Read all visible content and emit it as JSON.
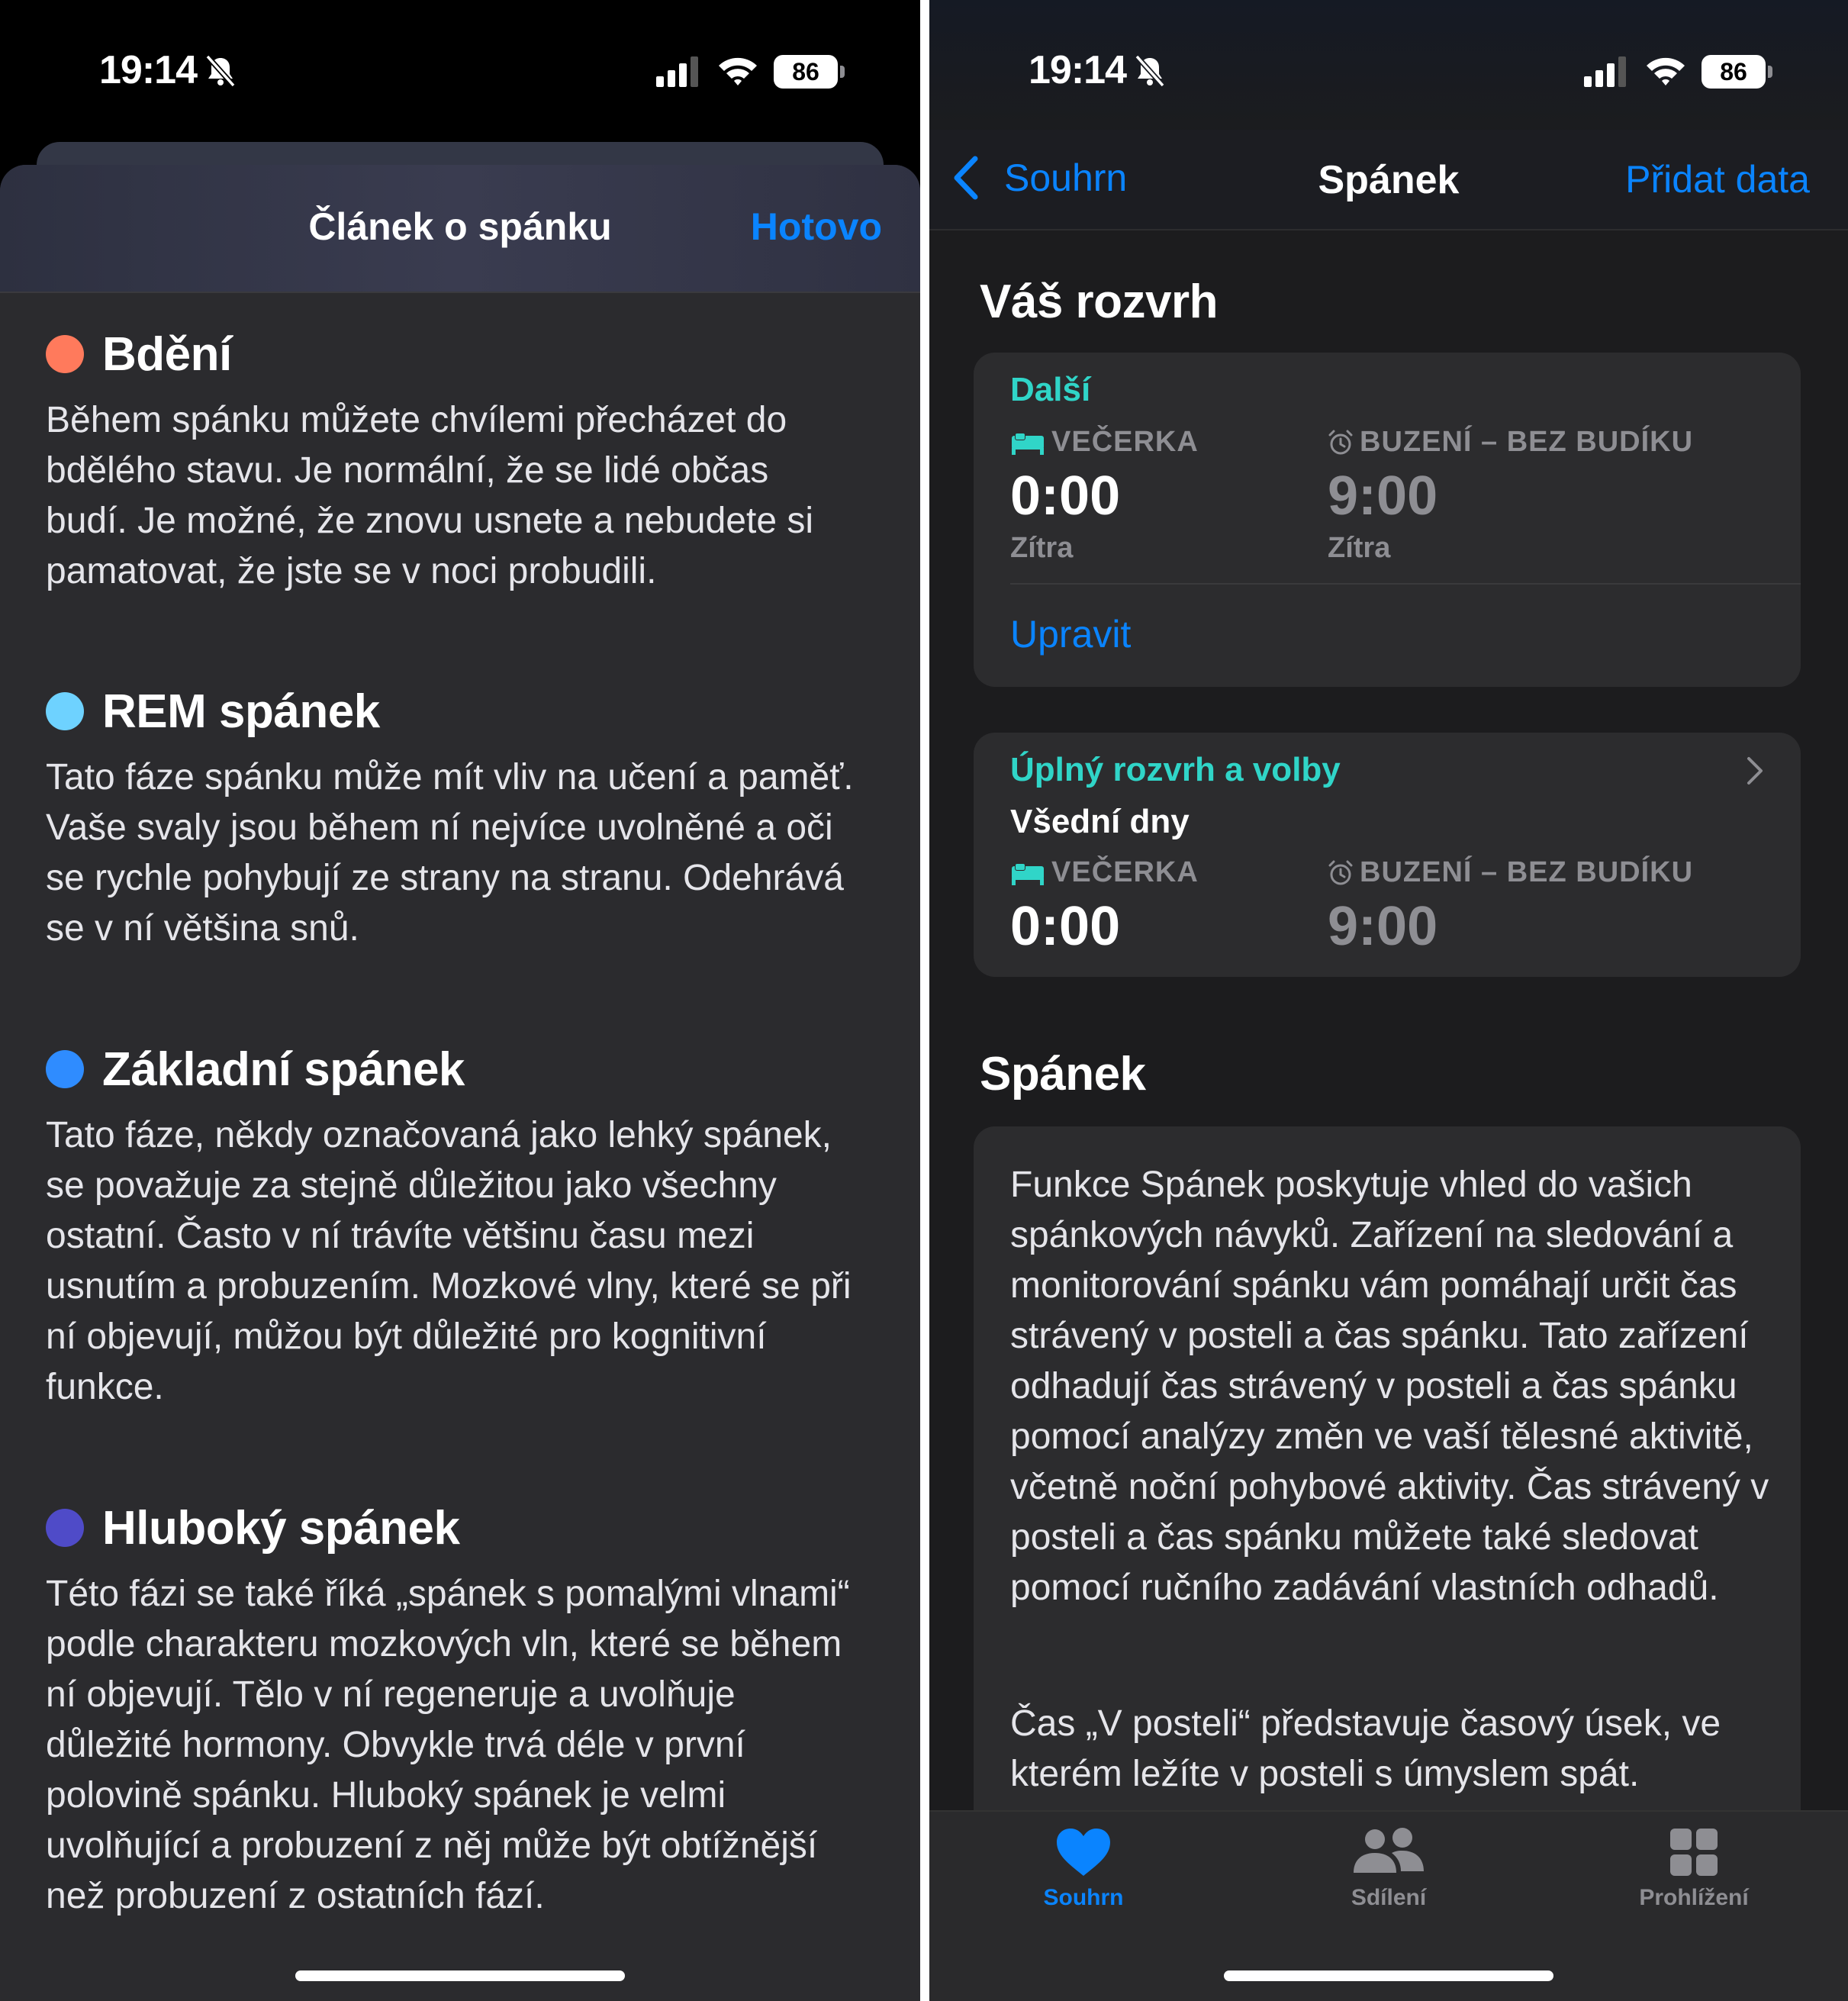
{
  "left": {
    "status": {
      "time": "19:14",
      "battery": "86"
    },
    "sheet": {
      "title": "Článek o spánku",
      "done_label": "Hotovo",
      "stages": [
        {
          "title": "Bdění",
          "color": "#ff7a5c",
          "text": "Během spánku můžete chvílemi přecházet do bdělého stavu. Je normální, že se lidé občas budí. Je možné, že znovu usnete a nebudete si pamatovat, že jste se v noci probudili."
        },
        {
          "title": "REM spánek",
          "color": "#6ed2ff",
          "text": "Tato fáze spánku může mít vliv na učení a paměť. Vaše svaly jsou během ní nejvíce uvolněné a oči se rychle pohybují ze strany na stranu. Odehrává se v ní většina snů."
        },
        {
          "title": "Základní spánek",
          "color": "#2f8cff",
          "text": "Tato fáze, někdy označovaná jako lehký spánek, se považuje za stejně důležitou jako všechny ostatní. Často v ní trávíte většinu času mezi usnutím a probuzením. Mozkové vlny, které se při ní objevují, můžou být důležité pro kognitivní funkce."
        },
        {
          "title": "Hluboký spánek",
          "color": "#4f4bc8",
          "text": "Této fázi se také říká „spánek s pomalými vlnami“ podle charakteru mozkových vln, které se během ní objevují. Tělo v ní regeneruje a uvolňuje důležité hormony. Obvykle trvá déle v první polovině spánku. Hluboký spánek je velmi uvolňující a probuzení z něj může být obtížnější než probuzení z ostatních fází."
        }
      ]
    }
  },
  "right": {
    "status": {
      "time": "19:14",
      "battery": "86"
    },
    "nav": {
      "back_label": "Souhrn",
      "title": "Spánek",
      "add_label": "Přidat data"
    },
    "schedule": {
      "section_title": "Váš rozvrh",
      "next_card": {
        "label": "Další",
        "bedtime_label": "VEČERKA",
        "bedtime_time": "0:00",
        "bedtime_day": "Zítra",
        "wake_label": "BUZENÍ – BEZ BUDÍKU",
        "wake_time": "9:00",
        "wake_day": "Zítra",
        "edit_label": "Upravit"
      },
      "full_card": {
        "label": "Úplný rozvrh a volby",
        "days": "Všední dny",
        "bedtime_label": "VEČERKA",
        "bedtime_time": "0:00",
        "wake_label": "BUZENÍ – BEZ BUDÍKU",
        "wake_time": "9:00"
      }
    },
    "sleep": {
      "section_title": "Spánek",
      "paragraph1": "Funkce Spánek poskytuje vhled do vašich spánkových návyků. Zařízení na sledování a monitorování spánku vám pomáhají určit čas strávený v posteli a čas spánku. Tato zařízení odhadují čas strávený v posteli a čas spánku pomocí analýzy změn ve vaší tělesné aktivitě, včetně noční pohybové aktivity. Čas strávený v posteli a čas spánku můžete také sledovat pomocí ručního zadávání vlastních odhadů.",
      "paragraph2": "Čas „V posteli“ představuje časový úsek, ve kterém ležíte v posteli s úmyslem spát."
    },
    "tabbar": {
      "tabs": [
        {
          "label": "Souhrn",
          "active": true
        },
        {
          "label": "Sdílení",
          "active": false
        },
        {
          "label": "Prohlížení",
          "active": false
        }
      ]
    }
  }
}
